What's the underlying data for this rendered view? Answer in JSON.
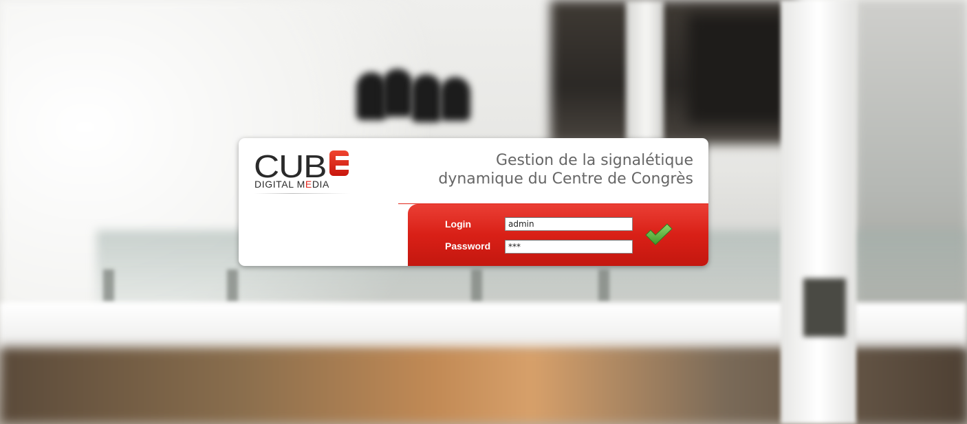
{
  "logo": {
    "brand_word": "CUB",
    "tagline_start": "DIGITAL M",
    "tagline_accent": "E",
    "tagline_end": "DIA"
  },
  "header": {
    "title_line1": "Gestion de la signalétique",
    "title_line2": "dynamique du Centre de Congrès"
  },
  "form": {
    "login_label": "Login",
    "login_value": "admin",
    "password_label": "Password",
    "password_value": "***"
  },
  "submit": {
    "icon": "checkmark-icon",
    "color": "#5cb83e"
  },
  "colors": {
    "accent_red": "#e2231a",
    "title_gray": "#666666",
    "card_white": "#ffffff"
  }
}
